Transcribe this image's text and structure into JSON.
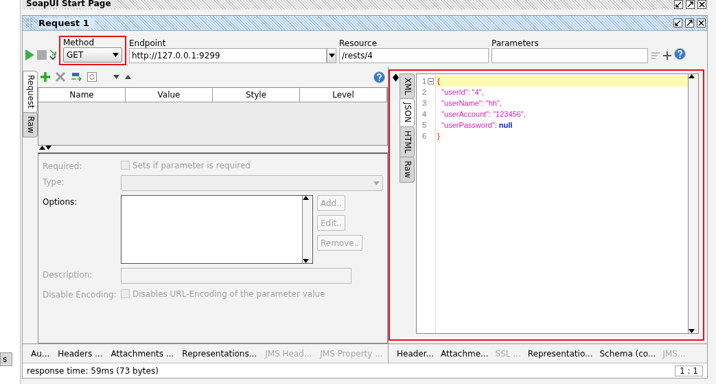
{
  "start_page_tab": {
    "title": "SoapUI Start Page"
  },
  "left_edge_tab": {
    "label": "s"
  },
  "request": {
    "icon_text": "REST",
    "title": "Request 1"
  },
  "toolbar": {
    "method": {
      "label": "Method",
      "value": "GET"
    },
    "endpoint": {
      "label": "Endpoint",
      "value": "http://127.0.0.1:9299"
    },
    "resource": {
      "label": "Resource",
      "value": "/rests/4"
    },
    "parameters": {
      "label": "Parameters"
    }
  },
  "request_pane": {
    "side_tabs": [
      {
        "label": "Request",
        "selected": true
      },
      {
        "label": "Raw",
        "selected": false
      }
    ],
    "table": {
      "columns": [
        "Name",
        "Value",
        "Style",
        "Level"
      ]
    },
    "form": {
      "required": {
        "label": "Required:",
        "checkbox_label": "Sets if parameter is required",
        "checked": false,
        "disabled": true
      },
      "type": {
        "label": "Type:",
        "disabled": true
      },
      "options": {
        "label": "Options:",
        "buttons": [
          {
            "label": "Add..",
            "disabled": true
          },
          {
            "label": "Edit..",
            "disabled": true
          },
          {
            "label": "Remove..",
            "disabled": true
          }
        ]
      },
      "description": {
        "label": "Description:",
        "disabled": true
      },
      "disable_encoding": {
        "label": "Disable Encoding:",
        "checkbox_label": "Disables URL-Encoding of the parameter value",
        "checked": false,
        "disabled": true
      }
    },
    "bottom_tabs": [
      {
        "label": "Au...",
        "disabled": false
      },
      {
        "label": "Headers ...",
        "disabled": false
      },
      {
        "label": "Attachments ...",
        "disabled": false
      },
      {
        "label": "Representations...",
        "disabled": false
      },
      {
        "label": "JMS Head...",
        "disabled": true
      },
      {
        "label": "JMS Property ...",
        "disabled": true
      }
    ]
  },
  "response_pane": {
    "side_tabs": [
      {
        "label": "XML",
        "selected": false
      },
      {
        "label": "JSON",
        "selected": true
      },
      {
        "label": "HTML",
        "selected": false
      },
      {
        "label": "Raw",
        "selected": false
      }
    ],
    "lines": [
      {
        "number": "1",
        "tokens": [
          {
            "kind": "punct",
            "text": "{"
          }
        ]
      },
      {
        "number": "2",
        "tokens": [
          {
            "kind": "key",
            "text": "  \"userId\": "
          },
          {
            "kind": "string",
            "text": "\"4\","
          }
        ]
      },
      {
        "number": "3",
        "tokens": [
          {
            "kind": "key",
            "text": "  \"userName\": "
          },
          {
            "kind": "string",
            "text": "\"hh\","
          }
        ]
      },
      {
        "number": "4",
        "tokens": [
          {
            "kind": "key",
            "text": "  \"userAccount\": "
          },
          {
            "kind": "string",
            "text": "\"123456\","
          }
        ]
      },
      {
        "number": "5",
        "tokens": [
          {
            "kind": "key",
            "text": "  \"userPassword\": "
          },
          {
            "kind": "null",
            "text": "null"
          }
        ]
      },
      {
        "number": "6",
        "tokens": [
          {
            "kind": "punct",
            "text": "}"
          }
        ]
      }
    ],
    "bottom_tabs": [
      {
        "label": "Header...",
        "disabled": false
      },
      {
        "label": "Attachme...",
        "disabled": false
      },
      {
        "label": "SSL ...",
        "disabled": true
      },
      {
        "label": "Representatio...",
        "disabled": false
      },
      {
        "label": "Schema (co...",
        "disabled": false
      },
      {
        "label": "JMS...",
        "disabled": true
      }
    ]
  },
  "status_bar": {
    "text": "response time: 59ms (73 bytes)",
    "position": "1 : 1"
  }
}
